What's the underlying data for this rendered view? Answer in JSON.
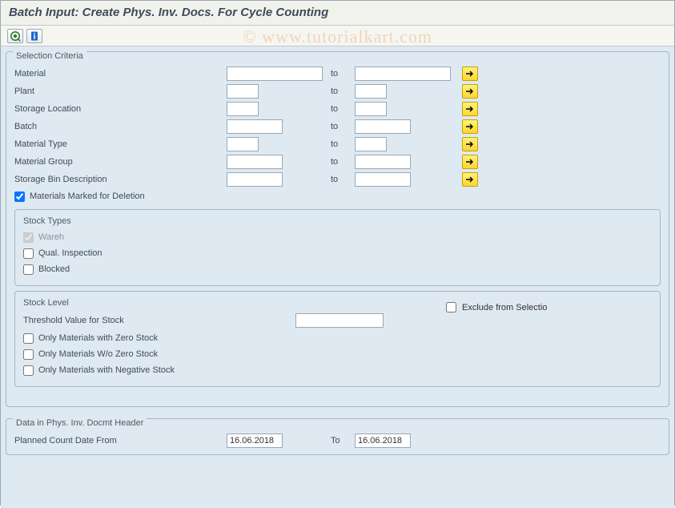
{
  "title": "Batch Input: Create Phys. Inv. Docs. For Cycle Counting",
  "watermark": "© www.tutorialkart.com",
  "toolbar": {
    "execute_icon": "execute",
    "info_icon": "info"
  },
  "groups": {
    "selection": {
      "legend": "Selection Criteria",
      "rows": [
        {
          "label": "Material",
          "from": "",
          "to": "",
          "size": "large"
        },
        {
          "label": "Plant",
          "from": "",
          "to": "",
          "size": "small"
        },
        {
          "label": "Storage Location",
          "from": "",
          "to": "",
          "size": "small"
        },
        {
          "label": "Batch",
          "from": "",
          "to": "",
          "size": "med"
        },
        {
          "label": "Material Type",
          "from": "",
          "to": "",
          "size": "small"
        },
        {
          "label": "Material Group",
          "from": "",
          "to": "",
          "size": "med"
        },
        {
          "label": "Storage Bin Description",
          "from": "",
          "to": "",
          "size": "med"
        }
      ],
      "to_label": "to",
      "materials_marked_for_deletion": "Materials Marked for Deletion",
      "mmd_checked": true
    },
    "stock_types": {
      "legend": "Stock Types",
      "wareh": "Wareh",
      "wareh_checked": true,
      "qual": "Qual. Inspection",
      "qual_checked": false,
      "blocked": "Blocked",
      "blocked_checked": false
    },
    "stock_level": {
      "legend": "Stock Level",
      "threshold_label": "Threshold Value for Stock",
      "threshold_value": "",
      "exclude": "Exclude from Selectio",
      "exclude_checked": false,
      "only_zero": "Only Materials with Zero Stock",
      "only_wo_zero": "Only Materials W/o Zero Stock",
      "only_neg": "Only Materials with Negative Stock"
    },
    "header": {
      "legend": "Data in Phys. Inv. Docmt Header",
      "planned_label": "Planned Count Date From",
      "planned_from": "16.06.2018",
      "planned_to_label": "To",
      "planned_to": "16.06.2018"
    }
  }
}
